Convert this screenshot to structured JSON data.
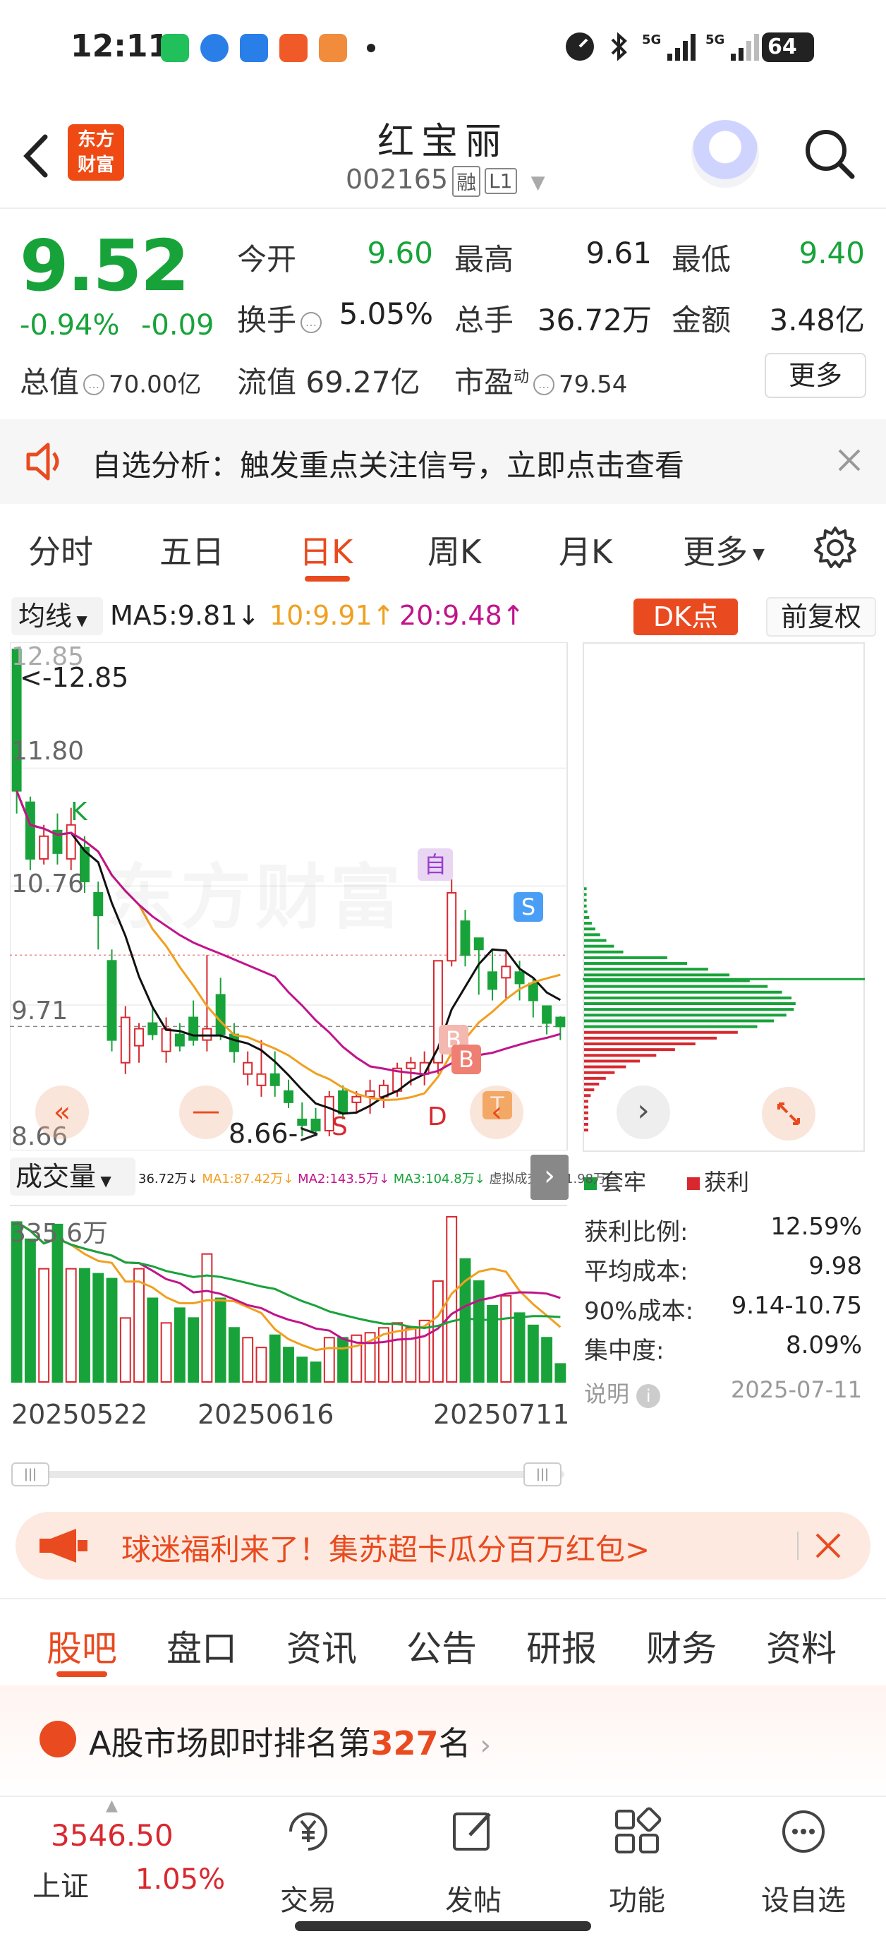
{
  "status_bar": {
    "time": "12:11",
    "battery": "64"
  },
  "header": {
    "name": "红宝丽",
    "code": "002165",
    "tag_rong": "融",
    "tag_level": "L1",
    "logo_text": "东方财富"
  },
  "quote": {
    "price": "9.52",
    "change_pct": "-0.94%",
    "change": "-0.09",
    "open_label": "今开",
    "open": "9.60",
    "high_label": "最高",
    "high": "9.61",
    "low_label": "最低",
    "low": "9.40",
    "turnover_label": "换手",
    "turnover": "5.05%",
    "volume_label": "总手",
    "volume": "36.72万",
    "amount_label": "金额",
    "amount": "3.48亿",
    "mktcap_label": "总值",
    "mktcap": "70.00亿",
    "float_label": "流值",
    "float_cap": "69.27亿",
    "pe_label": "市盈",
    "pe_sup": "动",
    "pe": "79.54",
    "more_button": "更多"
  },
  "notice": {
    "text": "自选分析：触发重点关注信号，立即点击查看"
  },
  "chart_tabs": [
    "分时",
    "五日",
    "日K",
    "周K",
    "月K",
    "更多"
  ],
  "chart_tabs_active": 2,
  "ma_bar": {
    "selector": "均线",
    "ma5": "MA5:9.81↓",
    "ma10": "10:9.91↑",
    "ma20": "20:9.48↑",
    "dk_button": "DK点",
    "adjust_button": "前复权",
    "colors": {
      "ma5": "#111111",
      "ma10": "#f0a020",
      "ma20": "#c0148a",
      "up": "#d8282f",
      "down": "#18a33a"
    }
  },
  "kline": {
    "price_labels": [
      "12.85",
      "11.80",
      "10.76",
      "9.71",
      "8.66"
    ],
    "high_marker": "<-12.85",
    "low_marker": "8.66->",
    "watermark": "东方财富",
    "signal_labels": {
      "k": "K",
      "self": "自",
      "s1": "S",
      "b1": "B",
      "b2": "B",
      "d": "D",
      "s2": "S",
      "t": "T"
    }
  },
  "volume_panel": {
    "selector": "成交量",
    "legend": [
      "36.72万↓",
      "MA1:87.42万↓",
      "MA2:143.5万↓",
      "MA3:104.8万↓",
      "虚拟成交量:61.98万"
    ],
    "max_label": "335.6万",
    "dates": [
      "20250522",
      "20250616",
      "20250711"
    ]
  },
  "chip_panel": {
    "legend_trapped": "套牢",
    "legend_profit": "获利",
    "stats": [
      {
        "label": "获利比例:",
        "value": "12.59%"
      },
      {
        "label": "平均成本:",
        "value": "9.98"
      },
      {
        "label": "90%成本:",
        "value": "9.14-10.75"
      },
      {
        "label": "集中度:",
        "value": "8.09%"
      }
    ],
    "note_label": "说明",
    "date": "2025-07-11"
  },
  "promo": {
    "text": "球迷福利来了！集苏超卡瓜分百万红包>"
  },
  "bottom_tabs": [
    "股吧",
    "盘口",
    "资讯",
    "公告",
    "研报",
    "财务",
    "资料"
  ],
  "bottom_tabs_active": 0,
  "rank": {
    "prefix": "A股市场即时排名第",
    "number": "327",
    "suffix": "名"
  },
  "bottom_nav": {
    "index_value": "3546.50",
    "index_name": "上证",
    "index_change": "1.05%",
    "items": [
      "交易",
      "发帖",
      "功能",
      "设自选"
    ]
  },
  "chart_data": {
    "type": "candlestick",
    "ohlc": [
      [
        12.85,
        12.85,
        11.4,
        11.6
      ],
      [
        11.5,
        11.55,
        10.9,
        11.0
      ],
      [
        11.0,
        11.3,
        10.95,
        11.2
      ],
      [
        11.25,
        11.4,
        10.95,
        11.05
      ],
      [
        11.0,
        11.45,
        10.9,
        11.3
      ],
      [
        11.1,
        11.2,
        10.7,
        10.8
      ],
      [
        10.7,
        10.8,
        10.2,
        10.5
      ],
      [
        10.1,
        10.2,
        9.3,
        9.4
      ],
      [
        9.2,
        9.7,
        9.1,
        9.6
      ],
      [
        9.35,
        9.55,
        9.2,
        9.5
      ],
      [
        9.55,
        9.7,
        9.4,
        9.45
      ],
      [
        9.3,
        9.6,
        9.2,
        9.5
      ],
      [
        9.45,
        9.55,
        9.3,
        9.35
      ],
      [
        9.6,
        9.75,
        9.35,
        9.4
      ],
      [
        9.4,
        10.15,
        9.3,
        9.5
      ],
      [
        9.8,
        9.95,
        9.4,
        9.45
      ],
      [
        9.45,
        9.55,
        9.2,
        9.3
      ],
      [
        9.1,
        9.3,
        9.0,
        9.2
      ],
      [
        9.0,
        9.4,
        8.9,
        9.1
      ],
      [
        9.1,
        9.3,
        8.9,
        9.0
      ],
      [
        8.95,
        9.05,
        8.8,
        8.85
      ],
      [
        8.7,
        8.85,
        8.55,
        8.65
      ],
      [
        8.7,
        8.8,
        8.55,
        8.6
      ],
      [
        8.6,
        8.95,
        8.55,
        8.9
      ],
      [
        8.95,
        9.0,
        8.7,
        8.75
      ],
      [
        8.85,
        8.95,
        8.75,
        8.9
      ],
      [
        8.9,
        9.05,
        8.75,
        8.95
      ],
      [
        8.9,
        9.05,
        8.8,
        9.0
      ],
      [
        8.95,
        9.2,
        8.9,
        9.15
      ],
      [
        9.15,
        9.25,
        9.0,
        9.2
      ],
      [
        9.1,
        9.3,
        9.0,
        9.2
      ],
      [
        9.2,
        10.1,
        9.1,
        10.1
      ],
      [
        10.1,
        10.95,
        10.05,
        10.7
      ],
      [
        10.45,
        10.55,
        10.05,
        10.15
      ],
      [
        10.3,
        10.3,
        9.8,
        10.2
      ],
      [
        10.0,
        10.2,
        9.75,
        9.85
      ],
      [
        9.95,
        10.2,
        9.75,
        10.05
      ],
      [
        10.0,
        10.1,
        9.75,
        9.9
      ],
      [
        9.9,
        9.95,
        9.6,
        9.75
      ],
      [
        9.7,
        9.7,
        9.45,
        9.55
      ],
      [
        9.6,
        9.61,
        9.4,
        9.52
      ]
    ],
    "volume_wan": [
      325,
      290,
      230,
      320,
      230,
      230,
      220,
      210,
      130,
      230,
      170,
      120,
      150,
      130,
      260,
      170,
      110,
      90,
      70,
      95,
      70,
      50,
      40,
      90,
      90,
      95,
      100,
      110,
      120,
      110,
      125,
      205,
      335.6,
      250,
      205,
      155,
      175,
      140,
      115,
      90,
      36.72
    ],
    "ylim": [
      8.55,
      12.85
    ],
    "volume_ylim": [
      0,
      335.6
    ]
  }
}
